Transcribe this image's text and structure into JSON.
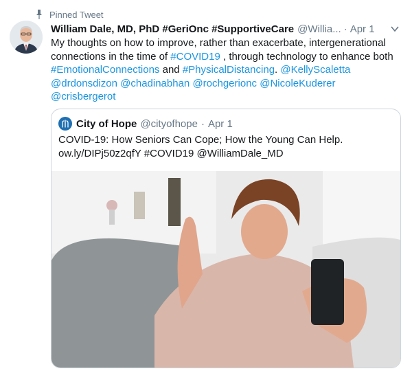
{
  "pinned": {
    "label": "Pinned Tweet"
  },
  "tweet": {
    "author": "William Dale, MD, PhD #GeriOnc #SupportiveCare",
    "handle": "@Willia...",
    "date": "Apr 1",
    "text_1": "My thoughts on how to improve, rather than exacerbate, intergenerational connections in the time of ",
    "hashtag_covid": "#COVID19",
    "text_2": " , through technology to enhance both ",
    "hashtag_emotional": "#EmotionalConnections",
    "text_and": " and ",
    "hashtag_physical": "#PhysicalDistancing",
    "text_3": ". ",
    "mentions": [
      "@KellyScaletta",
      "@drdonsdizon",
      "@chadinabhan",
      "@rochgerionc",
      "@NicoleKuderer",
      "@crisbergerot"
    ]
  },
  "quoted": {
    "name": "City of Hope",
    "handle": "@cityofhope",
    "date": "Apr 1",
    "text_line1": "COVID-19: How Seniors Can Cope; How the Young Can Help.",
    "text_line2": "ow.ly/DIPj50z2qfY #COVID19 @WilliamDale_MD"
  },
  "colors": {
    "link": "#1b95e0",
    "secondary": "#657786",
    "border": "#ccd6dd",
    "logo": "#1f6fb2"
  }
}
